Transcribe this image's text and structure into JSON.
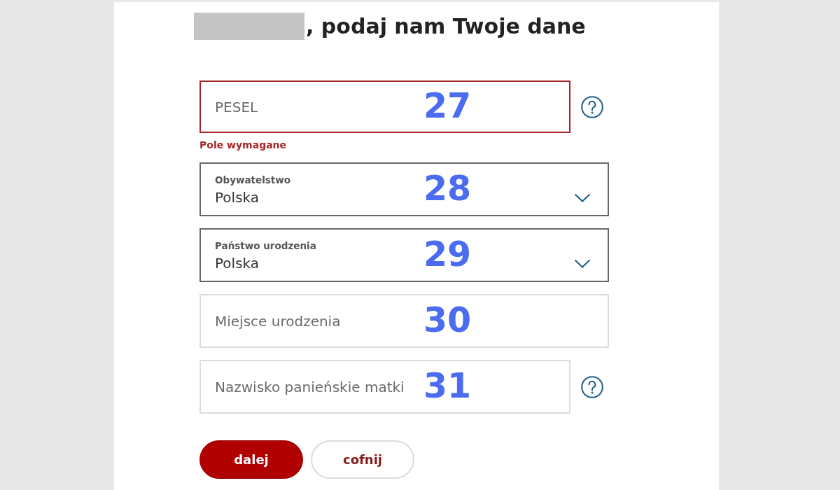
{
  "heading": {
    "redacted_name": true,
    "text": ", podaj nam Twoje dane"
  },
  "fields": [
    {
      "kind": "text",
      "placeholder": "PESEL",
      "annotation": "27",
      "help": true,
      "error": "Pole wymagane"
    },
    {
      "kind": "select",
      "label": "Obywatelstwo",
      "value": "Polska",
      "annotation": "28",
      "help": false
    },
    {
      "kind": "select",
      "label": "Państwo urodzenia",
      "value": "Polska",
      "annotation": "29",
      "help": false
    },
    {
      "kind": "text",
      "placeholder": "Miejsce urodzenia",
      "annotation": "30",
      "help": false
    },
    {
      "kind": "text",
      "placeholder": "Nazwisko panieńskie matki",
      "annotation": "31",
      "help": true
    }
  ],
  "buttons": [
    {
      "label": "dalej",
      "kind": "primary"
    },
    {
      "label": "cofnij",
      "kind": "secondary"
    }
  ]
}
